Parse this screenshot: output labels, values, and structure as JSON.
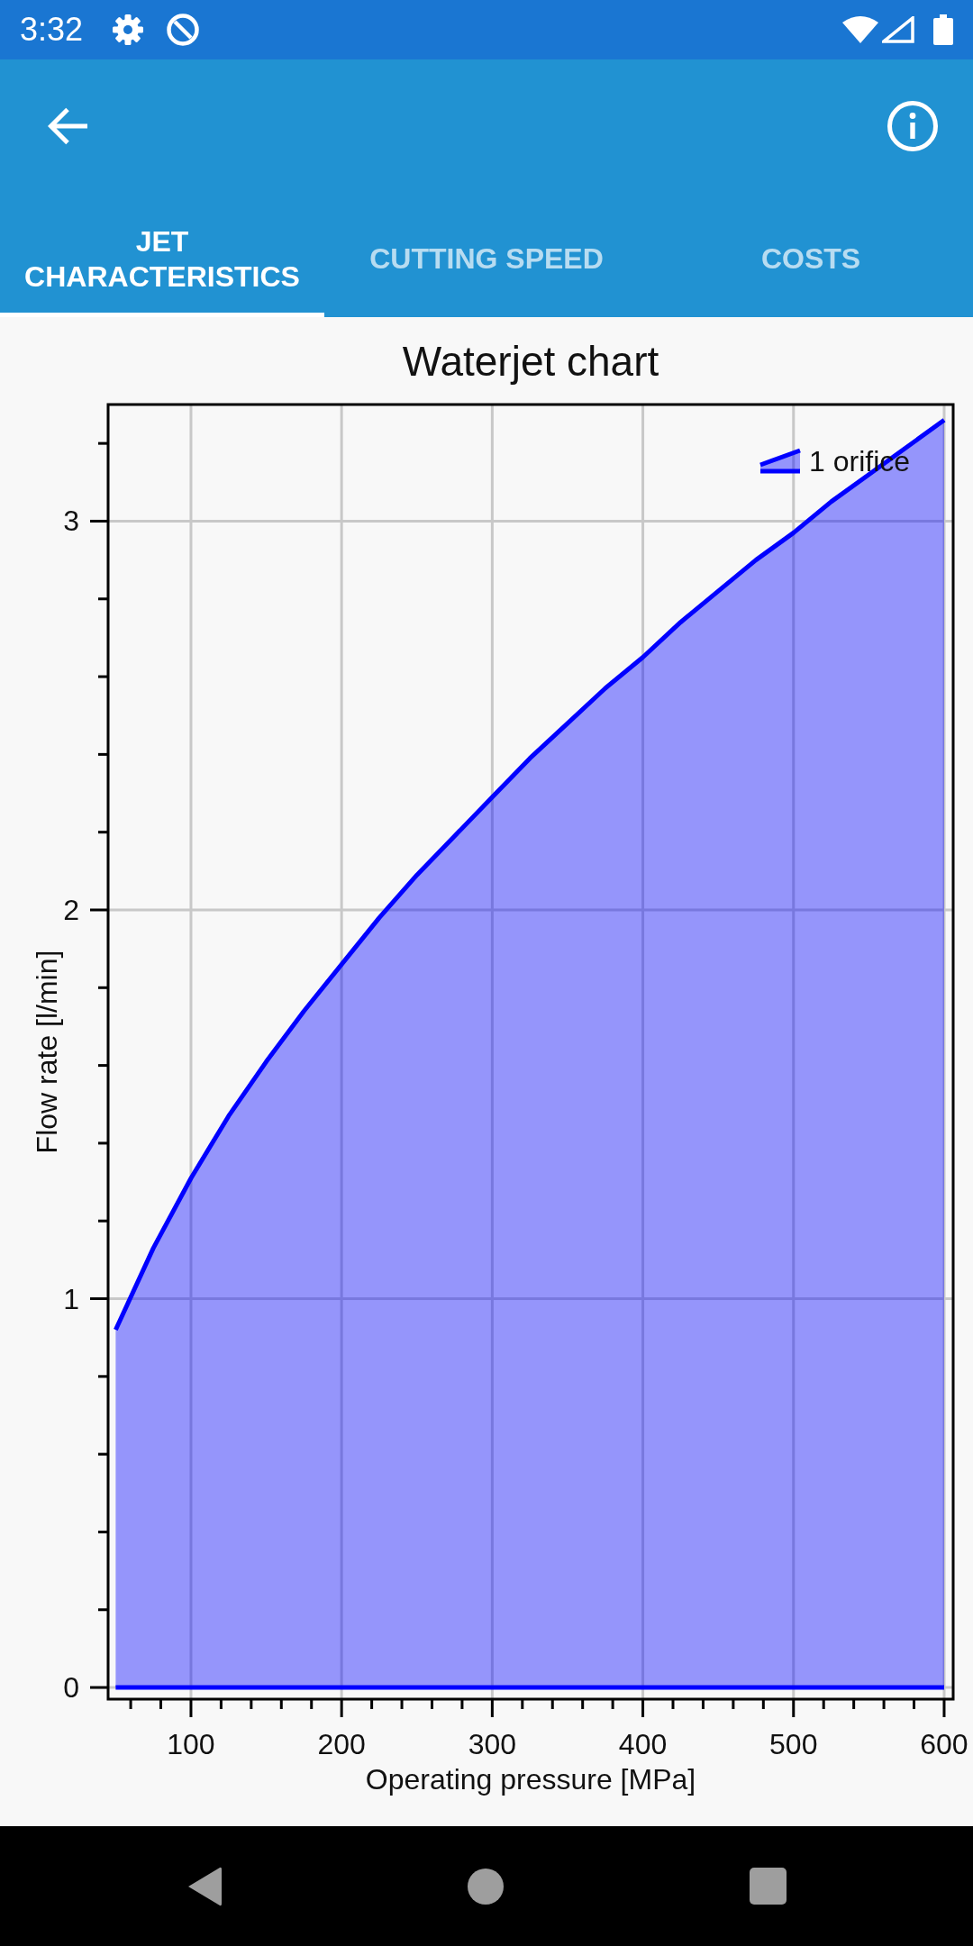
{
  "status_bar": {
    "time": "3:32"
  },
  "tabs": [
    {
      "label": "JET CHARACTERISTICS",
      "selected": true
    },
    {
      "label": "CUTTING SPEED",
      "selected": false
    },
    {
      "label": "COSTS",
      "selected": false
    }
  ],
  "chart": {
    "chart_data": {
      "type": "area",
      "title": "Waterjet chart",
      "xlabel": "Operating pressure [MPa]",
      "ylabel": "Flow rate [l/min]",
      "x": [
        50,
        75,
        100,
        125,
        150,
        175,
        200,
        225,
        250,
        275,
        300,
        325,
        350,
        375,
        400,
        425,
        450,
        475,
        500,
        525,
        550,
        575,
        600
      ],
      "series": [
        {
          "name": "1 orifice",
          "color": "#0000ff",
          "values": [
            0.92,
            1.13,
            1.31,
            1.47,
            1.61,
            1.74,
            1.86,
            1.98,
            2.09,
            2.19,
            2.29,
            2.39,
            2.48,
            2.57,
            2.65,
            2.74,
            2.82,
            2.9,
            2.97,
            3.05,
            3.12,
            3.19,
            3.26
          ]
        }
      ],
      "xlim": [
        45,
        606
      ],
      "ylim": [
        -0.03,
        3.3
      ],
      "xticks": [
        100,
        200,
        300,
        400,
        500,
        600
      ],
      "yticks": [
        0,
        1,
        2,
        3
      ],
      "grid": true,
      "ref_lines": [
        {
          "axis": "y",
          "value": 0,
          "color": "#0000ff"
        }
      ]
    }
  }
}
